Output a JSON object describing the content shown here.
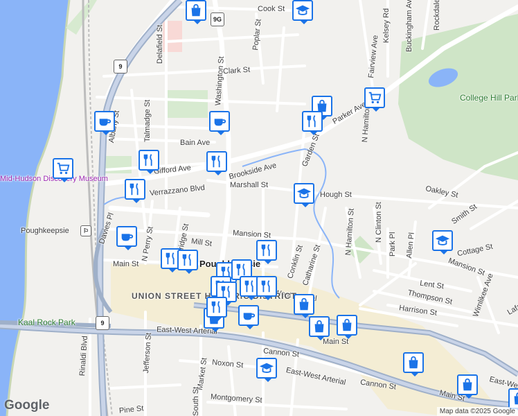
{
  "map": {
    "credit": "Map data ©2025 Google",
    "logo": "Google",
    "district_label": "UNION STREET HISTORIC DISTRICT",
    "city_label": "Poughkeepsie",
    "park_college_hill": "College Hill Park",
    "park_kaal_rock": "Kaal Rock Park",
    "museum_label": "Mid-Hudson Discovery Museum",
    "station_label": "Poughkeepsie",
    "route_9g": "9G",
    "route_9a": "9",
    "route_9b": "9",
    "streets": {
      "cook": "Cook St",
      "poplar": "Poplar St",
      "clark": "Clark St",
      "delafield": "Delafield St",
      "washington": "Washington St",
      "kelsey": "Kelsey Rd",
      "buckingham": "Buckingham Ave",
      "rockdale": "Rockdale Ave",
      "fairview": "Fairview Ave",
      "parker": "Parker Ave",
      "nhamilton_top": "N Hamilton St",
      "talmadge": "Talmadge St",
      "bain": "Bain Ave",
      "gifford": "Gifford Ave",
      "brookside": "Brookside Ave",
      "verrazzano": "Verrazzano Blvd",
      "marshall": "Marshall St",
      "garden": "Garden St",
      "hough": "Hough St",
      "oakley": "Oakley St",
      "smith": "Smith St",
      "davies": "Davies Pl",
      "nperry": "N Perry St",
      "bridge": "Bridge St",
      "mill": "Mill St",
      "mansion_w": "Mansion St",
      "nhamilton_mid": "N Hamilton St",
      "nclinton": "N Clinton St",
      "park_pl": "Park Pl",
      "allen": "Allen Pl",
      "cottage": "Cottage St",
      "main_w": "Main St",
      "conklin": "Conklin St",
      "catharine": "Catharine St",
      "mansion_e": "Mansion St",
      "lent": "Lent St",
      "thompson": "Thompson St",
      "harrison": "Harrison St",
      "wimlikee": "Wimlikee Ave",
      "lafayette": "Lafayette Pl",
      "eastwest_1": "East-West Arterial",
      "eastwest_2": "East-West Arterial",
      "eastwest_3": "East-West Arterial",
      "eastwest_4": "East-West",
      "cannon_1": "Cannon St",
      "cannon_2": "Cannon St",
      "main_e": "Main St",
      "main_se": "Main St",
      "jefferson": "Jefferson St",
      "rinaldi": "Rinaldi Blvd",
      "market": "Market St",
      "noxon": "Noxon St",
      "montgomery": "Montgomery St",
      "pine": "Pine St",
      "south": "South St",
      "alley_nw": "Albany St"
    }
  }
}
